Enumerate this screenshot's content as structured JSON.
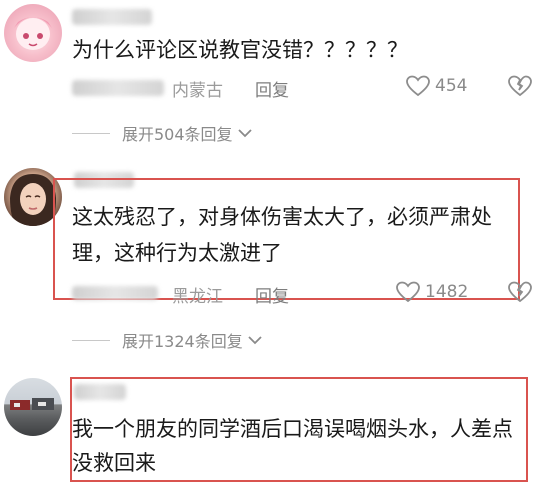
{
  "comments": [
    {
      "text": "为什么评论区说教官没错？？？？？",
      "location": "内蒙古",
      "reply_label": "回复",
      "likes": "454"
    },
    {
      "text_line1": "这太残忍了，对身体伤害太大了，必须严肃处",
      "text_line2": "理，这种行为太激进了",
      "location": "黑龙江",
      "reply_label": "回复",
      "likes": "1482"
    },
    {
      "text_line1": "我一个朋友的同学酒后口渴误喝烟头水，人差点",
      "text_line2": "没救回来"
    }
  ],
  "expand": [
    {
      "label": "展开504条回复"
    },
    {
      "label": "展开1324条回复"
    }
  ],
  "colors": {
    "highlight": "#d9534f",
    "meta_gray": "#9b9b9b"
  }
}
